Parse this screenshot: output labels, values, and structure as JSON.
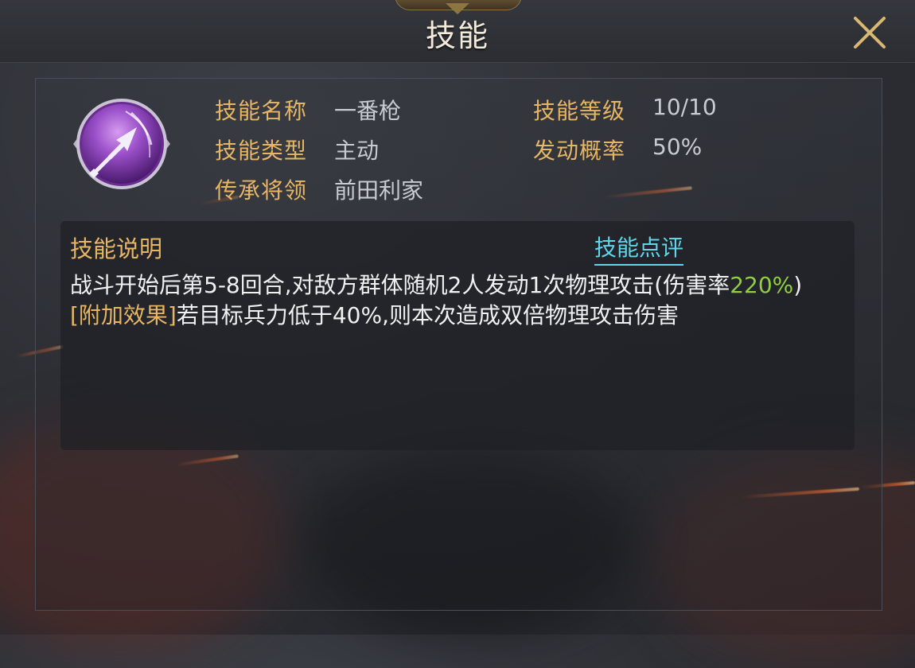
{
  "header": {
    "title": "技能"
  },
  "skill": {
    "icon": "spear-icon",
    "name_label": "技能名称",
    "name_value": "一番枪",
    "level_label": "技能等级",
    "level_value": "10/10",
    "type_label": "技能类型",
    "type_value": "主动",
    "rate_label": "发动概率",
    "rate_value": "50%",
    "inherit_label": "传承将领",
    "inherit_value": "前田利家"
  },
  "description": {
    "title": "技能说明",
    "review_link": "技能点评",
    "line1_text": "战斗开始后第5-8回合,对敌方群体随机2人发动1次物理攻击(伤害率",
    "line1_highlight": "220%",
    "line1_close": ")",
    "extra_tag": "[附加效果]",
    "extra_text": "若目标兵力低于40%,则本次造成双倍物理攻击伤害"
  },
  "colors": {
    "label_gold": "#e7b664",
    "value_gray": "#c8cbd0",
    "highlight_green": "#8fd03c",
    "link_cyan": "#5fd6ea",
    "icon_purple": "#8a3fb8"
  }
}
